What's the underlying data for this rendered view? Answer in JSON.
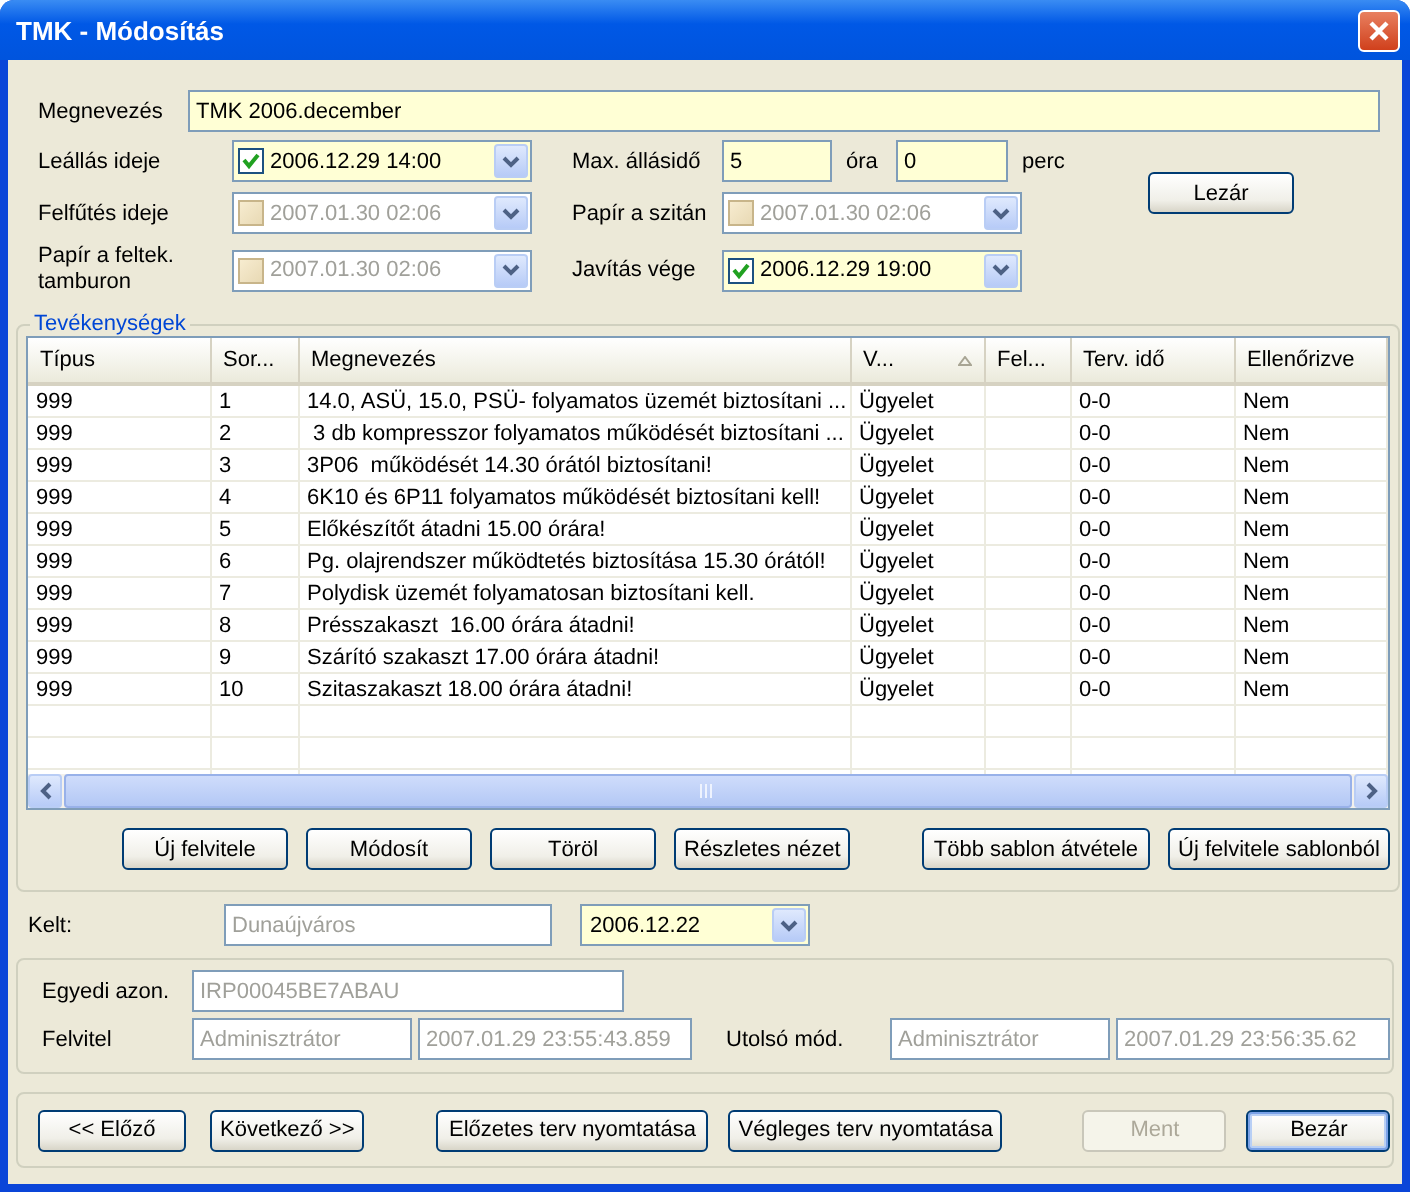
{
  "window": {
    "title": "TMK - Módosítás"
  },
  "name_field": {
    "label": "Megnevezés",
    "value": "TMK 2006.december"
  },
  "stop_time": {
    "label": "Leállás ideje",
    "value": "2006.12.29 14:00",
    "checked": true,
    "disabled": false
  },
  "max_downtime": {
    "label": "Max. állásidő",
    "hours": "5",
    "hours_unit": "óra",
    "minutes": "0",
    "minutes_unit": "perc"
  },
  "heating_time": {
    "label": "Felfűtés ideje",
    "value": "2007.01.30 02:06",
    "checked": false,
    "disabled": true
  },
  "paper_on_screen": {
    "label": "Papír a szitán",
    "value": "2007.01.30 02:06",
    "checked": false,
    "disabled": true
  },
  "close_record_button": "Lezár",
  "paper_on_drum": {
    "label": "Papír a feltek. tamburon",
    "value": "2007.01.30 02:06",
    "checked": false,
    "disabled": true
  },
  "repair_end": {
    "label": "Javítás vége",
    "value": "2006.12.29 19:00",
    "checked": true,
    "disabled": false
  },
  "activities": {
    "title": "Tevékenységek",
    "columns": [
      {
        "label": "Típus",
        "sorted": false
      },
      {
        "label": "Sor...",
        "sorted": false
      },
      {
        "label": "Megnevezés",
        "sorted": false
      },
      {
        "label": "V...",
        "sorted": true
      },
      {
        "label": "Fel...",
        "sorted": false
      },
      {
        "label": "Terv. idő",
        "sorted": false
      },
      {
        "label": "Ellenőrizve",
        "sorted": false
      }
    ],
    "rows": [
      [
        "999",
        "1",
        "14.0, ASÜ, 15.0, PSÜ- folyamatos üzemét biztosítani ...",
        "Ügyelet",
        "",
        "0-0",
        "Nem"
      ],
      [
        "999",
        "2",
        " 3 db kompresszor folyamatos működését biztosítani ...",
        "Ügyelet",
        "",
        "0-0",
        "Nem"
      ],
      [
        "999",
        "3",
        "3P06  működését 14.30 órától biztosítani!",
        "Ügyelet",
        "",
        "0-0",
        "Nem"
      ],
      [
        "999",
        "4",
        "6K10 és 6P11 folyamatos működését biztosítani kell!",
        "Ügyelet",
        "",
        "0-0",
        "Nem"
      ],
      [
        "999",
        "5",
        "Előkészítőt átadni 15.00 órára!",
        "Ügyelet",
        "",
        "0-0",
        "Nem"
      ],
      [
        "999",
        "6",
        "Pg. olajrendszer működtetés biztosítása 15.30 órától!",
        "Ügyelet",
        "",
        "0-0",
        "Nem"
      ],
      [
        "999",
        "7",
        "Polydisk üzemét folyamatosan biztosítani kell.",
        "Ügyelet",
        "",
        "0-0",
        "Nem"
      ],
      [
        "999",
        "8",
        "Présszakaszt  16.00 órára átadni!",
        "Ügyelet",
        "",
        "0-0",
        "Nem"
      ],
      [
        "999",
        "9",
        "Szárító szakaszt 17.00 órára átadni!",
        "Ügyelet",
        "",
        "0-0",
        "Nem"
      ],
      [
        "999",
        "10",
        "Szitaszakaszt 18.00 órára átadni!",
        "Ügyelet",
        "",
        "0-0",
        "Nem"
      ]
    ],
    "buttons": [
      "Új felvitele",
      "Módosít",
      "Töröl",
      "Részletes nézet"
    ],
    "template_buttons": [
      "Több sablon átvétele",
      "Új felvitele sablonból"
    ]
  },
  "issued": {
    "label": "Kelt:",
    "place": "Dunaújváros",
    "place_disabled": true,
    "date": "2006.12.22"
  },
  "record": {
    "id_label": "Egyedi azon.",
    "id": "IRP00045BE7ABAU",
    "created_label": "Felvitel",
    "created_by": "Adminisztrátor",
    "created_at": "2007.01.29 23:55:43.859",
    "modified_label": "Utolsó mód.",
    "modified_by": "Adminisztrátor",
    "modified_at": "2007.01.29 23:56:35.62"
  },
  "footer_buttons": [
    {
      "label": "<< Előző",
      "disabled": false,
      "default": false
    },
    {
      "label": "Következő >>",
      "disabled": false,
      "default": false
    },
    {
      "label": "Előzetes terv nyomtatása",
      "disabled": false,
      "default": false
    },
    {
      "label": "Végleges terv nyomtatása",
      "disabled": false,
      "default": false
    },
    {
      "label": "Ment",
      "disabled": true,
      "default": false
    },
    {
      "label": "Bezár",
      "disabled": false,
      "default": true
    }
  ]
}
